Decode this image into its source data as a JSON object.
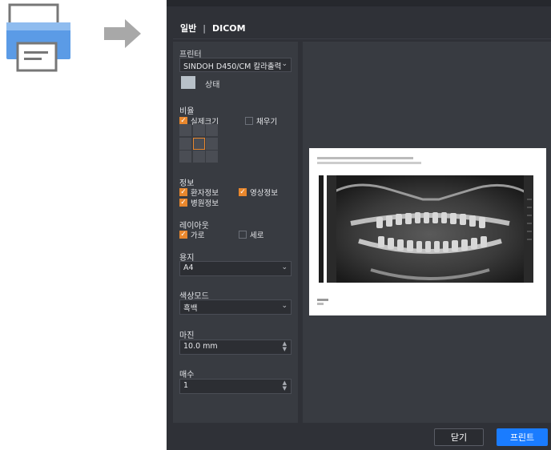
{
  "tabs": {
    "general": "일반",
    "separator": "|",
    "dicom": "DICOM"
  },
  "printer": {
    "label": "프린터",
    "selected": "SINDOH D450/CM 칼라출력",
    "status_label": "상태"
  },
  "ratio": {
    "label": "비율",
    "actual_size": "실제크기",
    "actual_size_checked": true,
    "fill": "채우기",
    "fill_checked": false
  },
  "info": {
    "label": "정보",
    "patient_info": "환자정보",
    "image_info": "영상정보",
    "hospital_info": "병원정보"
  },
  "layout": {
    "label": "레이아웃",
    "landscape": "가로",
    "portrait": "세로"
  },
  "paper": {
    "label": "용지",
    "selected": "A4"
  },
  "color_mode": {
    "label": "색상모드",
    "selected": "흑백"
  },
  "margin": {
    "label": "마진",
    "value": "10.0 mm"
  },
  "copies": {
    "label": "매수",
    "value": "1"
  },
  "buttons": {
    "close": "닫기",
    "print": "프린트"
  },
  "colors": {
    "accent": "#e8872d",
    "primary_button": "#1a7cff",
    "dialog_bg": "#2f3137",
    "panel_bg": "#383b41"
  }
}
